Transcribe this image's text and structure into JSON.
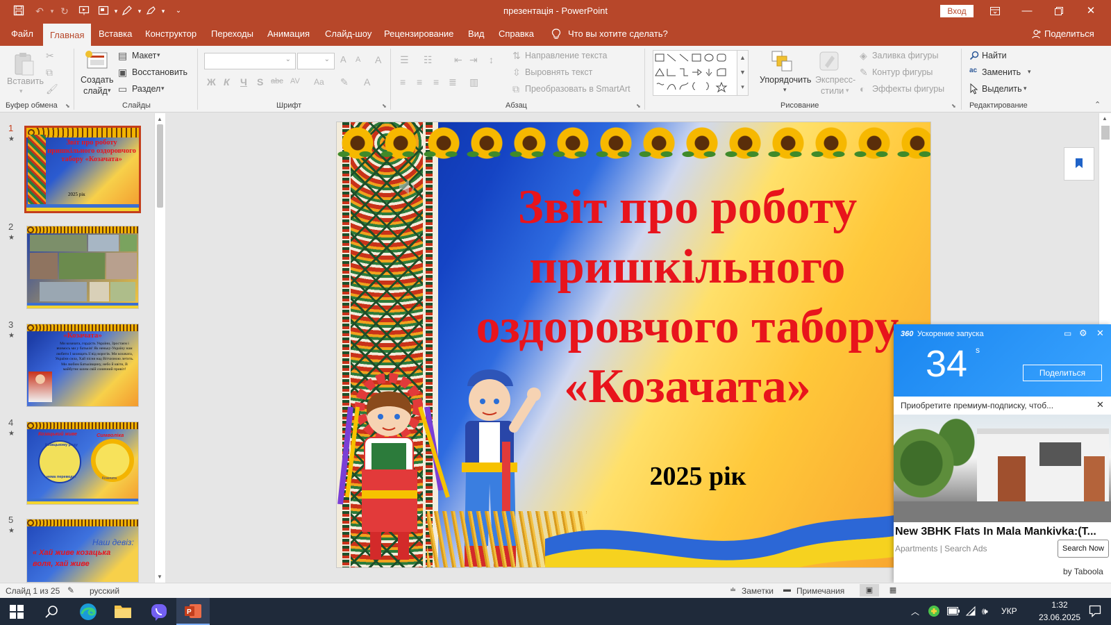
{
  "window": {
    "title": "презентація  -  PowerPoint",
    "signin_label": "Вход"
  },
  "menu": {
    "items": [
      "Файл",
      "Главная",
      "Вставка",
      "Конструктор",
      "Переходы",
      "Анимация",
      "Слайд-шоу",
      "Рецензирование",
      "Вид",
      "Справка"
    ],
    "active": "Главная",
    "tell_me": "Что вы хотите сделать?",
    "share": "Поделиться"
  },
  "ribbon": {
    "clipboard": {
      "paste": "Вставить",
      "label": "Буфер обмена"
    },
    "slides": {
      "new_slide_1": "Создать",
      "new_slide_2": "слайд",
      "layout": "Макет",
      "reset": "Восстановить",
      "section": "Раздел",
      "label": "Слайды"
    },
    "font": {
      "label": "Шрифт",
      "bold": "Ж",
      "italic": "К",
      "underline": "Ч",
      "shadow": "S",
      "strike": "abc",
      "spacing": "AV",
      "case": "Aa",
      "size_up": "A",
      "size_down": "A",
      "clear": "A",
      "color": "A"
    },
    "paragraph": {
      "label": "Абзац",
      "text_direction": "Направление текста",
      "align_text": "Выровнять текст",
      "smartart": "Преобразовать в SmartArt"
    },
    "drawing": {
      "label": "Рисование",
      "arrange": "Упорядочить",
      "quick_styles_1": "Экспресс-",
      "quick_styles_2": "стили",
      "fill": "Заливка фигуры",
      "outline": "Контур фигуры",
      "effects": "Эффекты фигуры"
    },
    "editing": {
      "label": "Редактирование",
      "find": "Найти",
      "replace": "Заменить",
      "select": "Выделить"
    }
  },
  "thumbnails": [
    {
      "num": "1",
      "title": "Звіт про роботу пришкільного оздоровчого табору «Козачата»",
      "year": "2025 рік"
    },
    {
      "num": "2"
    },
    {
      "num": "3",
      "title": "«Козачата»",
      "body": "Ми козачата, гордість України, Зростаєм і вчимось ми у батьків! Як неньку-Україну нам любити І захищать її від ворогів. Ми козачата, України сила, Хай пісня над Вітчизною летить. Ми любим Батьківщину, небо й квіти, В майбутнє шлем свій сонячний привіт!"
    },
    {
      "num": "4",
      "left": "Козацький живе",
      "right": "Символіка",
      "ring1": "Козацькому роду",
      "ring2": "нема переводу!",
      "badge": "Козачата"
    },
    {
      "num": "5",
      "heading": "Наш девіз:",
      "line1": "« Хай живе козацька",
      "line2": "воля, хай живе"
    }
  ],
  "slide": {
    "title_lines": [
      "Звіт про роботу",
      "пришкільного",
      "оздоровчого табору",
      "«Козачата»"
    ],
    "year": "2025 рік"
  },
  "ad": {
    "brand": "360",
    "header": "Ускорение запуска",
    "timer": "34",
    "timer_unit": "s",
    "share_btn": "Поделиться",
    "promo": "Приобретите премиум-подписку, чтоб...",
    "headline": "New 3BHK Flats In Mala Mankivka:(T...",
    "source": "Apartments | Search Ads",
    "cta": "Search Now",
    "by": "by Taboola"
  },
  "status": {
    "slide_info": "Слайд 1 из 25",
    "language": "русский",
    "notes": "Заметки",
    "comments": "Примечания"
  },
  "taskbar": {
    "lang": "УКР",
    "time": "1:32",
    "date": "23.06.2025"
  },
  "colors": {
    "accent": "#b7472a",
    "slide_title": "#e8141c"
  }
}
